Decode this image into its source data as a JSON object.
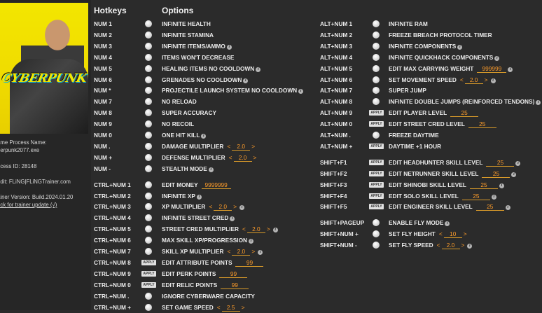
{
  "sidebar": {
    "process_name_label": "ame Process Name:",
    "process_name": "berpunk2077.exe",
    "process_id": "ocess ID: 28148",
    "credit": "edit: FLiNG|FLiNGTrainer.com",
    "version": "ainer Version: Build.2024.01.20",
    "update_link": "eck for trainer update (√)",
    "cover_logo": "CYBERPUNK"
  },
  "headers": {
    "hotkeys": "Hotkeys",
    "options": "Options"
  },
  "colors": {
    "background": "#2b2b2b",
    "value": "#ff9d2a",
    "text": "#ebebeb"
  },
  "left_rows": [
    {
      "key": "NUM 1",
      "label": "INFINITE HEALTH",
      "info": false,
      "apply": false
    },
    {
      "key": "NUM 2",
      "label": "INFINITE STAMINA",
      "info": false,
      "apply": false
    },
    {
      "key": "NUM 3",
      "label": "INFINITE ITEMS/AMMO",
      "info": true,
      "apply": false
    },
    {
      "key": "NUM 4",
      "label": "ITEMS WON'T DECREASE",
      "info": false,
      "apply": false
    },
    {
      "key": "NUM 5",
      "label": "HEALING ITEMS NO COOLDOWN",
      "info": true,
      "apply": false
    },
    {
      "key": "NUM 6",
      "label": "GRENADES NO COOLDOWN",
      "info": true,
      "apply": false
    },
    {
      "key": "NUM *",
      "label": "PROJECTILE LAUNCH SYSTEM NO COOLDOWN",
      "info": true,
      "apply": false
    },
    {
      "key": "NUM 7",
      "label": "NO RELOAD",
      "info": false,
      "apply": false
    },
    {
      "key": "NUM 8",
      "label": "SUPER ACCURACY",
      "info": false,
      "apply": false
    },
    {
      "key": "NUM 9",
      "label": "NO RECOIL",
      "info": false,
      "apply": false
    },
    {
      "key": "NUM 0",
      "label": "ONE HIT KILL",
      "info": true,
      "apply": false
    },
    {
      "key": "NUM .",
      "label": "DAMAGE MULTIPLIER",
      "stepper": "2.0",
      "info": false,
      "apply": false
    },
    {
      "key": "NUM +",
      "label": "DEFENSE MULTIPLIER",
      "stepper": "2.0",
      "info": false,
      "apply": false
    },
    {
      "key": "NUM -",
      "label": "STEALTH MODE",
      "info": true,
      "apply": false
    },
    {
      "key": "CTRL+NUM 1",
      "label": "EDIT MONEY",
      "value": "9999999",
      "info": false,
      "apply": false,
      "gap": true
    },
    {
      "key": "CTRL+NUM 2",
      "label": "INFINITE XP",
      "info": true,
      "apply": false
    },
    {
      "key": "CTRL+NUM 3",
      "label": "XP MULTIPLIER",
      "stepper": "2.0",
      "info": true,
      "apply": false
    },
    {
      "key": "CTRL+NUM 4",
      "label": "INFINITE STREET CRED",
      "info": true,
      "apply": false
    },
    {
      "key": "CTRL+NUM 5",
      "label": "STREET CRED MULTIPLIER",
      "stepper": "2.0",
      "info": true,
      "apply": false
    },
    {
      "key": "CTRL+NUM 6",
      "label": "MAX SKILL XP/PROGRESSION",
      "info": true,
      "apply": false
    },
    {
      "key": "CTRL+NUM 7",
      "label": "SKILL XP MULTIPLIER",
      "stepper": "2.0",
      "info": true,
      "apply": false
    },
    {
      "key": "CTRL+NUM 8",
      "label": "EDIT ATTRIBUTE POINTS",
      "value": "99",
      "info": false,
      "apply": true
    },
    {
      "key": "CTRL+NUM 9",
      "label": "EDIT PERK POINTS",
      "value": "99",
      "info": false,
      "apply": true
    },
    {
      "key": "CTRL+NUM 0",
      "label": "EDIT RELIC POINTS",
      "value": "99",
      "info": false,
      "apply": true
    },
    {
      "key": "CTRL+NUM .",
      "label": "IGNORE CYBERWARE CAPACITY",
      "info": false,
      "apply": false
    },
    {
      "key": "CTRL+NUM +",
      "label": "SET GAME SPEED",
      "stepper": "2.5",
      "info": false,
      "apply": false
    }
  ],
  "right_rows": [
    {
      "key": "ALT+NUM 1",
      "label": "INFINITE RAM",
      "info": false,
      "apply": false
    },
    {
      "key": "ALT+NUM 2",
      "label": "FREEZE BREACH PROTOCOL TIMER",
      "info": false,
      "apply": false
    },
    {
      "key": "ALT+NUM 3",
      "label": "INFINITE COMPONENTS",
      "info": true,
      "apply": false
    },
    {
      "key": "ALT+NUM 4",
      "label": "INFINITE QUICKHACK COMPONENTS",
      "info": true,
      "apply": false
    },
    {
      "key": "ALT+NUM 5",
      "label": "EDIT MAX CARRYING WEIGHT",
      "value": "999999",
      "info": true,
      "apply": false
    },
    {
      "key": "ALT+NUM 6",
      "label": "SET MOVEMENT SPEED",
      "stepper": "2.0",
      "info": true,
      "apply": false
    },
    {
      "key": "ALT+NUM 7",
      "label": "SUPER JUMP",
      "info": false,
      "apply": false
    },
    {
      "key": "ALT+NUM 8",
      "label": "INFINITE DOUBLE JUMPS (REINFORCED TENDONS)",
      "info": true,
      "apply": false
    },
    {
      "key": "ALT+NUM 9",
      "label": "EDIT PLAYER LEVEL",
      "value": "25",
      "info": false,
      "apply": true
    },
    {
      "key": "ALT+NUM 0",
      "label": "EDIT STREET CRED LEVEL",
      "value": "25",
      "info": false,
      "apply": true
    },
    {
      "key": "ALT+NUM .",
      "label": "FREEZE DAYTIME",
      "info": false,
      "apply": false
    },
    {
      "key": "ALT+NUM +",
      "label": "DAYTIME +1 HOUR",
      "info": false,
      "apply": true
    },
    {
      "key": "SHIFT+F1",
      "label": "EDIT HEADHUNTER SKILL LEVEL",
      "value": "25",
      "info": true,
      "apply": true,
      "gap": true
    },
    {
      "key": "SHIFT+F2",
      "label": "EDIT NETRUNNER SKILL LEVEL",
      "value": "25",
      "info": true,
      "apply": true
    },
    {
      "key": "SHIFT+F3",
      "label": "EDIT SHINOBI SKILL LEVEL",
      "value": "25",
      "info": true,
      "apply": true
    },
    {
      "key": "SHIFT+F4",
      "label": "EDIT SOLO SKILL LEVEL",
      "value": "25",
      "info": true,
      "apply": true
    },
    {
      "key": "SHIFT+F5",
      "label": "EDIT ENGINEER SKILL LEVEL",
      "value": "25",
      "info": true,
      "apply": true
    },
    {
      "key": "SHIFT+PAGEUP",
      "label": "ENABLE FLY MODE",
      "info": true,
      "apply": false,
      "gap": true
    },
    {
      "key": "SHIFT+NUM +",
      "label": "SET FLY HEIGHT",
      "stepper": "10",
      "info": false,
      "apply": false
    },
    {
      "key": "SHIFT+NUM -",
      "label": "SET FLY SPEED",
      "stepper": "2.0",
      "info": true,
      "apply": false
    }
  ]
}
